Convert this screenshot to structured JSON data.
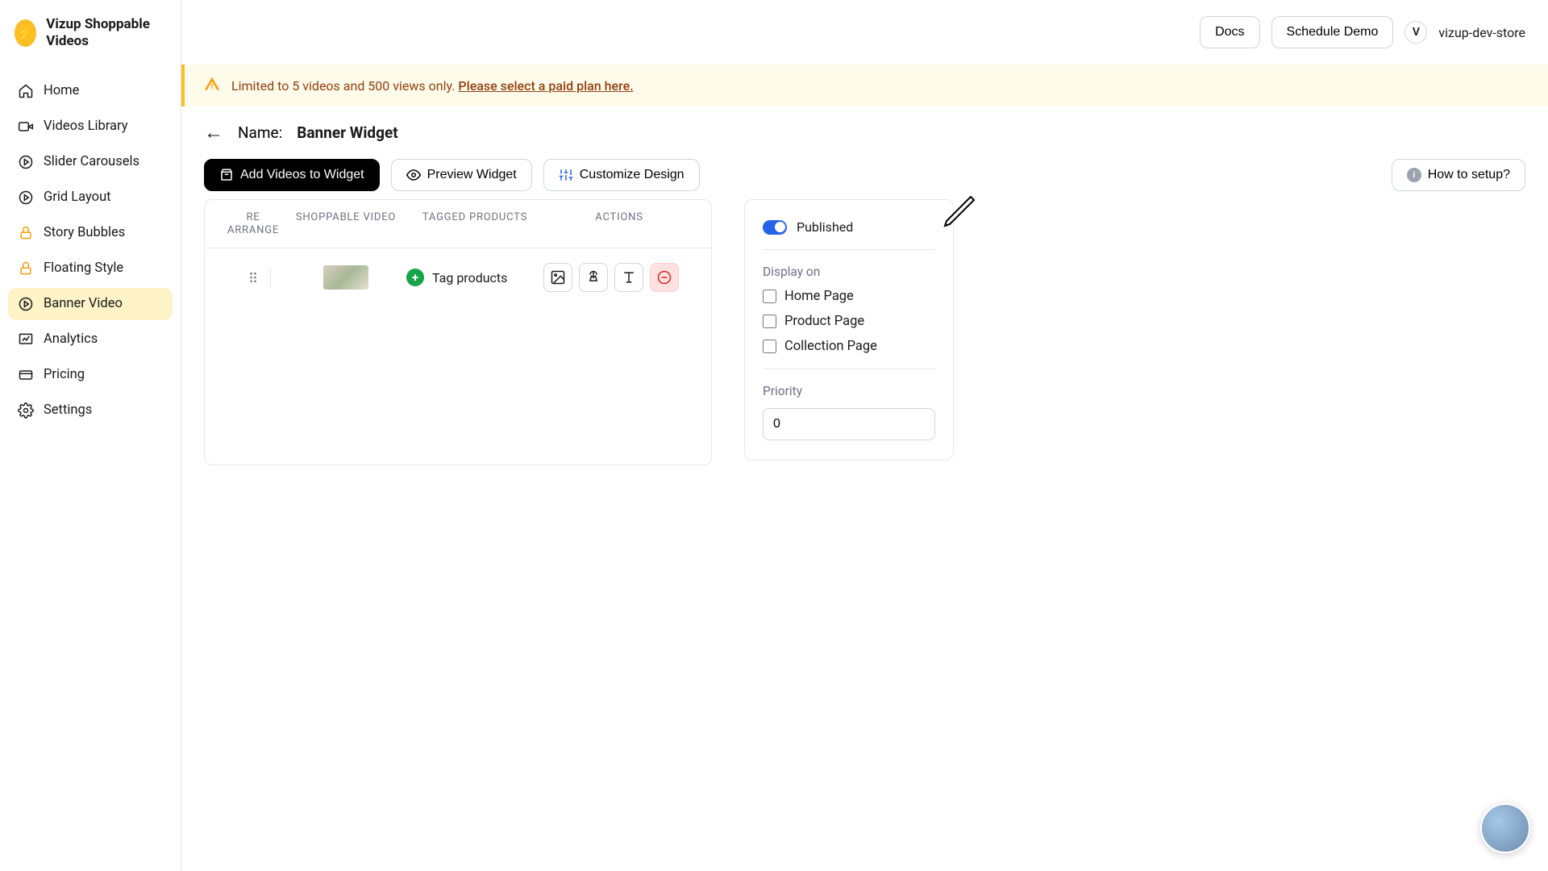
{
  "brand": {
    "name": "Vizup Shoppable Videos"
  },
  "sidebar": {
    "items": [
      {
        "label": "Home"
      },
      {
        "label": "Videos Library"
      },
      {
        "label": "Slider Carousels"
      },
      {
        "label": "Grid Layout"
      },
      {
        "label": "Story Bubbles"
      },
      {
        "label": "Floating Style"
      },
      {
        "label": "Banner Video"
      },
      {
        "label": "Analytics"
      },
      {
        "label": "Pricing"
      },
      {
        "label": "Settings"
      }
    ]
  },
  "topbar": {
    "docs": "Docs",
    "schedule": "Schedule Demo",
    "avatar_letter": "V",
    "account": "vizup-dev-store"
  },
  "banner": {
    "text": "Limited to 5 videos and 500 views only. ",
    "link": "Please select a paid plan here."
  },
  "header": {
    "name_label": "Name:",
    "name_value": "Banner Widget"
  },
  "toolbar": {
    "add": "Add Videos to Widget",
    "preview": "Preview Widget",
    "customize": "Customize Design",
    "howto": "How to setup?"
  },
  "table": {
    "head": {
      "rearr": "RE ARRANGE",
      "video": "SHOPPABLE VIDEO",
      "tagged": "TAGGED PRODUCTS",
      "actions": "ACTIONS"
    },
    "row0": {
      "tag_label": "Tag products"
    }
  },
  "side": {
    "published": "Published",
    "display_on": "Display on",
    "home": "Home Page",
    "product": "Product Page",
    "collection": "Collection Page",
    "priority_label": "Priority",
    "priority_value": "0"
  }
}
